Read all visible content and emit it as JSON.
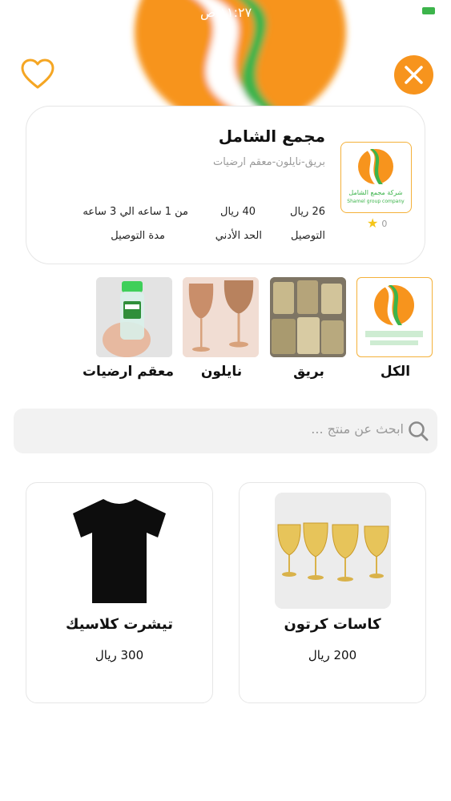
{
  "status_bar": {
    "time": "١١:٢٧ ص"
  },
  "store": {
    "name": "مجمع الشامل",
    "categories_text": "بريق-نايلون-معقم ارضيات",
    "logo_text": "شركة مجمع الشامل",
    "logo_subtext": "Shamel group company",
    "rating": "0",
    "delivery_fee": {
      "value": "26 ريال",
      "label": "التوصيل"
    },
    "min_order": {
      "value": "40 ريال",
      "label": "الحد الأدني"
    },
    "delivery_time": {
      "value": "من 1 ساعه الي 3 ساعه",
      "label": "مدة التوصيل"
    }
  },
  "categories": [
    {
      "label": "الكل",
      "icon": "store-logo",
      "selected": true
    },
    {
      "label": "بريق",
      "icon": "glitter-products"
    },
    {
      "label": "نايلون",
      "icon": "nylon-glasses"
    },
    {
      "label": "معقم ارضيات",
      "icon": "sanitizer-bottle"
    }
  ],
  "search": {
    "placeholder": "ابحث عن منتج ..."
  },
  "products": [
    {
      "name": "كاسات كرتون",
      "price": "200 ريال",
      "image": "gold-glasses"
    },
    {
      "name": "تيشرت كلاسيك",
      "price": "300 ريال",
      "image": "black-tshirt"
    }
  ],
  "colors": {
    "accent": "#f7941d",
    "green": "#3cb44b",
    "logo_border": "#f4b13a",
    "card_border": "#e6e6e6"
  }
}
